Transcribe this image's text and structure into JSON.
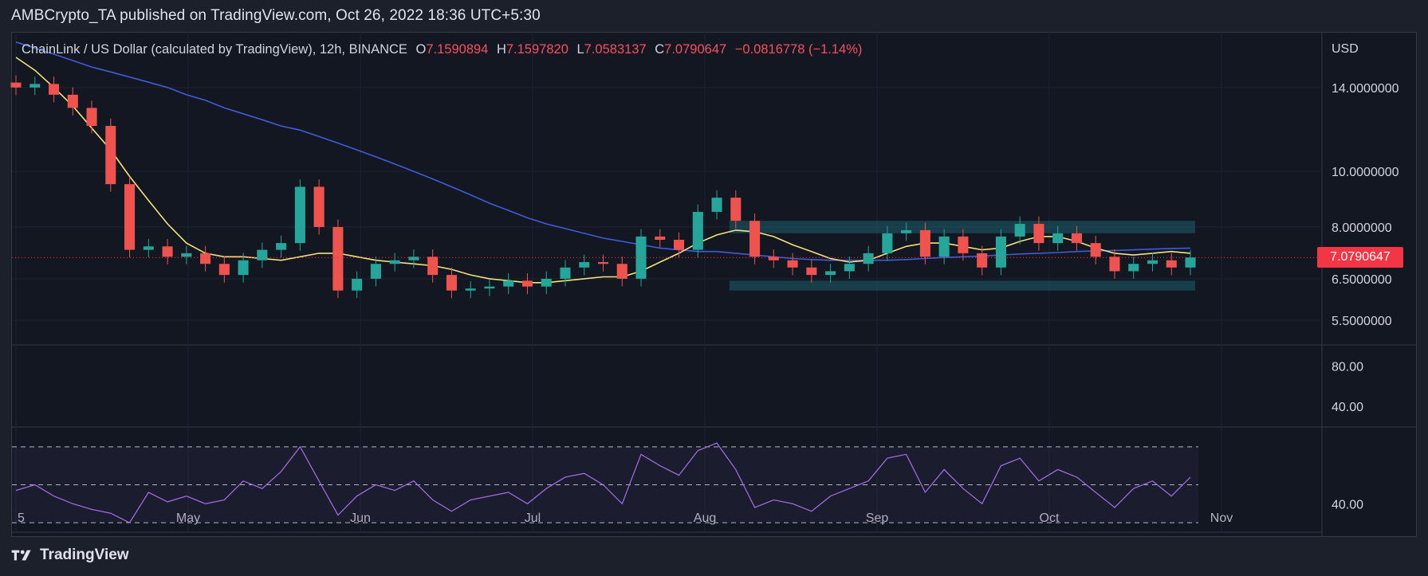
{
  "header": {
    "published": "AMBCrypto_TA published on TradingView.com, Oct 26, 2022 18:36 UTC+5:30"
  },
  "legend": {
    "symbol": "ChainLink / US Dollar (calculated by TradingView), 12h, BINANCE",
    "o_label": "O",
    "o_value": "7.1590894",
    "h_label": "H",
    "h_value": "7.1597820",
    "l_label": "L",
    "l_value": "7.0583137",
    "c_label": "C",
    "c_value": "7.0790647",
    "change": "−0.0816778 (−1.14%)"
  },
  "price_axis": {
    "currency": "USD",
    "last_price": "7.0790647"
  },
  "footer": {
    "brand": "TradingView"
  },
  "colors": {
    "background": "#131722",
    "up": "#26a69a",
    "down": "#ef5350",
    "ma_fast": "#f5e17a",
    "ma_slow": "#3f5bd9",
    "rsi": "#9c6ade",
    "range_box": "#1d6f7a",
    "last_price_tag": "#f23645"
  },
  "chart_data": [
    {
      "type": "candlestick",
      "title": "",
      "x": [
        "Apr 25",
        "Apr 28",
        "May 1",
        "May 4",
        "May 7",
        "May 10",
        "May 12",
        "May 15",
        "May 18",
        "May 21",
        "May 24",
        "May 27",
        "May 30",
        "Jun 2",
        "Jun 5",
        "Jun 8",
        "Jun 10",
        "Jun 13",
        "Jun 16",
        "Jun 19",
        "Jun 22",
        "Jun 25",
        "Jun 28",
        "Jul 1",
        "Jul 4",
        "Jul 7",
        "Jul 10",
        "Jul 13",
        "Jul 16",
        "Jul 19",
        "Jul 22",
        "Jul 25",
        "Jul 28",
        "Jul 31",
        "Aug 3",
        "Aug 6",
        "Aug 9",
        "Aug 12",
        "Aug 15",
        "Aug 18",
        "Aug 21",
        "Aug 24",
        "Aug 27",
        "Aug 30",
        "Sep 2",
        "Sep 5",
        "Sep 8",
        "Sep 11",
        "Sep 14",
        "Sep 17",
        "Sep 20",
        "Sep 23",
        "Sep 26",
        "Sep 29",
        "Oct 2",
        "Oct 5",
        "Oct 8",
        "Oct 11",
        "Oct 14",
        "Oct 17",
        "Oct 20",
        "Oct 23",
        "Oct 26"
      ],
      "close": [
        14.0,
        14.2,
        13.6,
        12.9,
        12.0,
        9.5,
        7.3,
        7.4,
        7.1,
        7.2,
        6.9,
        6.6,
        7.0,
        7.3,
        7.5,
        9.4,
        8.0,
        6.2,
        6.5,
        6.9,
        7.0,
        7.1,
        6.6,
        6.2,
        6.25,
        6.3,
        6.45,
        6.3,
        6.5,
        6.8,
        6.95,
        6.9,
        6.5,
        7.7,
        7.6,
        7.3,
        8.5,
        9.0,
        8.2,
        7.1,
        7.0,
        6.8,
        6.6,
        6.7,
        6.9,
        7.2,
        7.8,
        7.9,
        7.1,
        7.7,
        7.2,
        6.8,
        7.7,
        8.1,
        7.5,
        7.8,
        7.5,
        7.1,
        6.7,
        6.9,
        7.0,
        6.8,
        7.08
      ],
      "ma_fast": [
        15.8,
        15.0,
        14.0,
        13.0,
        11.9,
        10.9,
        9.8,
        8.9,
        8.1,
        7.5,
        7.2,
        7.1,
        7.1,
        7.05,
        7.0,
        7.1,
        7.2,
        7.2,
        7.1,
        7.0,
        6.95,
        6.9,
        6.85,
        6.75,
        6.6,
        6.5,
        6.45,
        6.4,
        6.4,
        6.45,
        6.5,
        6.55,
        6.55,
        6.7,
        6.95,
        7.2,
        7.5,
        7.75,
        7.9,
        7.85,
        7.7,
        7.45,
        7.25,
        7.05,
        6.95,
        7.0,
        7.2,
        7.4,
        7.5,
        7.5,
        7.4,
        7.3,
        7.35,
        7.55,
        7.7,
        7.7,
        7.55,
        7.35,
        7.2,
        7.15,
        7.2,
        7.25,
        7.2
      ],
      "ma_slow": [
        16.8,
        16.4,
        16.0,
        15.6,
        15.2,
        14.9,
        14.6,
        14.3,
        14.0,
        13.6,
        13.3,
        12.9,
        12.6,
        12.3,
        12.0,
        11.8,
        11.5,
        11.2,
        10.9,
        10.6,
        10.3,
        10.0,
        9.7,
        9.4,
        9.1,
        8.8,
        8.55,
        8.3,
        8.1,
        7.95,
        7.8,
        7.65,
        7.55,
        7.45,
        7.35,
        7.3,
        7.25,
        7.25,
        7.2,
        7.15,
        7.1,
        7.05,
        7.02,
        7.0,
        7.0,
        7.0,
        7.0,
        7.02,
        7.05,
        7.08,
        7.1,
        7.12,
        7.15,
        7.18,
        7.2,
        7.22,
        7.25,
        7.27,
        7.28,
        7.3,
        7.32,
        7.34,
        7.35
      ],
      "range_zones": [
        [
          7.8,
          8.2
        ],
        [
          6.2,
          6.45
        ]
      ],
      "ylabel": "USD",
      "y_ticks": [
        "14.0000000",
        "10.0000000",
        "8.0000000",
        "6.5000000",
        "5.5000000"
      ],
      "x_ticks": [
        "5",
        "May",
        "Jun",
        "Jul",
        "Aug",
        "Sep",
        "Oct",
        "Nov"
      ],
      "ylim": [
        5.0,
        17.5
      ],
      "y_scale": "log",
      "grid": true,
      "last_price": 7.0790647
    },
    {
      "type": "line",
      "title": "",
      "name": "",
      "y_ticks": [
        "80.00",
        "40.00"
      ],
      "ylim": [
        20,
        100
      ],
      "values": []
    },
    {
      "type": "line",
      "title": "",
      "series_name": "",
      "y_ticks": [
        "40.00"
      ],
      "bands": [
        70,
        50,
        30
      ],
      "ylim": [
        25,
        80
      ],
      "values": [
        47,
        50,
        44,
        40,
        37,
        35,
        30,
        46,
        41,
        44,
        40,
        42,
        52,
        48,
        57,
        70,
        52,
        34,
        44,
        50,
        47,
        52,
        42,
        36,
        42,
        44,
        46,
        40,
        48,
        54,
        56,
        50,
        40,
        66,
        60,
        55,
        68,
        72,
        58,
        38,
        42,
        40,
        36,
        44,
        48,
        52,
        64,
        66,
        46,
        58,
        48,
        40,
        60,
        64,
        52,
        58,
        54,
        46,
        38,
        48,
        52,
        44,
        54
      ]
    }
  ]
}
